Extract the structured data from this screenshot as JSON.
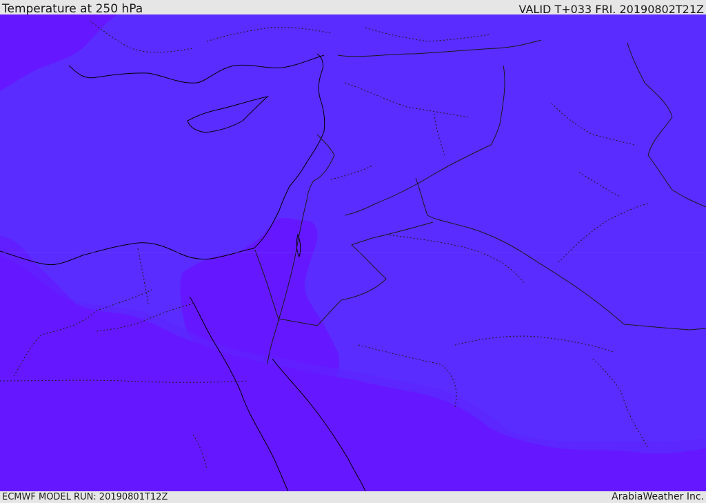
{
  "header": {
    "title": "Temperature at 250 hPa",
    "valid": "VALID T+033 FRI. 20190802T21Z"
  },
  "footer": {
    "model_run": "ECMWF MODEL RUN: 20190801T12Z",
    "brand": "ArabiaWeather Inc."
  },
  "map": {
    "field": "temperature-250hpa",
    "colors": {
      "base": "#5a2cff",
      "warm_band": "#6518ff",
      "transition": "#5e24ff",
      "coastline": "#000000",
      "border": "#1a1a1a"
    }
  }
}
